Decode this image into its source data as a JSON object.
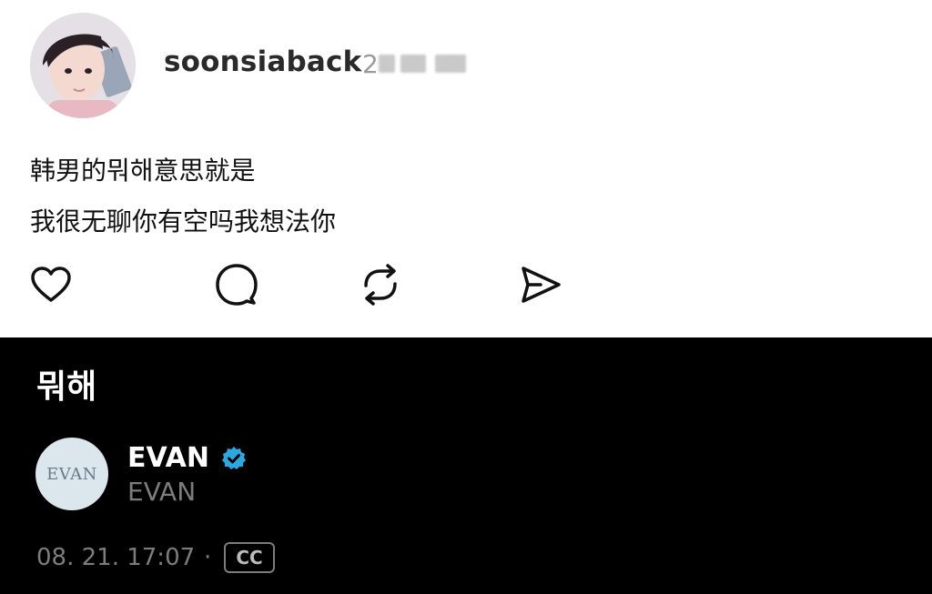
{
  "post": {
    "username": "soonsiaback",
    "time_prefix": "2",
    "lines": [
      "韩男的뭐해意思就是",
      "我很无聊你有空吗我想法你"
    ],
    "actions": [
      "heart-icon",
      "comment-icon",
      "repost-icon",
      "share-icon"
    ]
  },
  "reply": {
    "title": "뭐해",
    "avatar_text": "EVAN",
    "name": "EVAN",
    "handle": "EVAN",
    "timestamp": "08. 21. 17:07",
    "separator": "·",
    "cc_label": "CC",
    "verified_color": "#2aa9e0"
  }
}
